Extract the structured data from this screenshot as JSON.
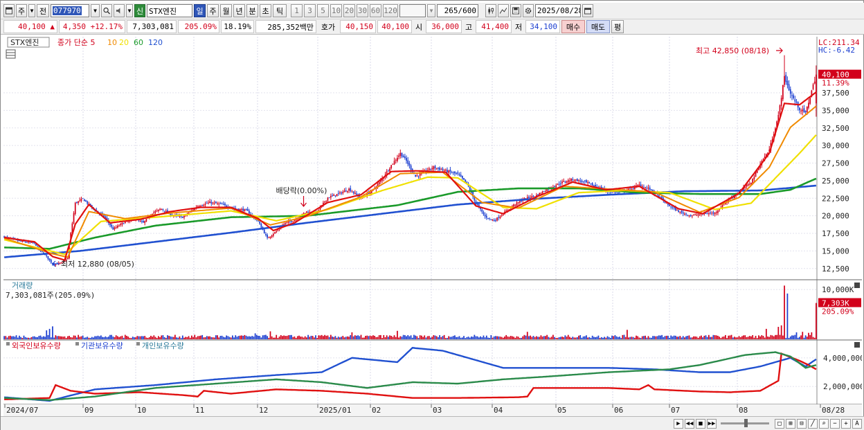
{
  "toolbar": {
    "mode_button": "주",
    "prev_button": "전",
    "stock_code": "077970",
    "new_badge": "신",
    "stock_name": "STX엔진",
    "period_tabs": [
      "일",
      "주",
      "월",
      "년",
      "분",
      "초",
      "틱"
    ],
    "active_period": "일",
    "interval_buttons": [
      "1",
      "3",
      "5",
      "10",
      "20",
      "30",
      "60",
      "120"
    ],
    "count_value": "265",
    "count_max": "/600",
    "date_value": "2025/08/28"
  },
  "quote": {
    "price": "40,100",
    "change_arrow": "▲",
    "change": "4,350",
    "change_pct": "+12.17%",
    "volume": "7,303,081",
    "volume_ratio": "205.09%",
    "turnover": "18.19%",
    "amount": "285,352백만",
    "bid_label": "호가",
    "ask_price": "40,150",
    "bid_price": "40,100",
    "open_label": "시",
    "open": "36,000",
    "high_label": "고",
    "high": "41,400",
    "low_label": "저",
    "low": "34,100",
    "buy_button": "매수",
    "sell_button": "매도",
    "eval_button": "평"
  },
  "colors": {
    "up": "#d2001b",
    "down": "#1c3fd0",
    "ma5": "#e01010",
    "ma10": "#f08a00",
    "ma20": "#f0e000",
    "ma60": "#1a9a2a",
    "ma120": "#2050d0",
    "foreign": "#2050d0",
    "institution": "#e01010",
    "individual": "#2a8a4a"
  },
  "chart_data": [
    {
      "type": "candlestick",
      "title": "STX엔진",
      "legend": {
        "price_label": "종가 단순",
        "periods": [
          "5",
          "10",
          "20",
          "60",
          "120"
        ]
      },
      "ylim": [
        11000,
        44500
      ],
      "yticks": [
        "37,500",
        "35,000",
        "32,500",
        "30,000",
        "27,500",
        "25,000",
        "22,500",
        "20,000",
        "17,500",
        "15,000",
        "12,500"
      ],
      "xticks": [
        "2024/07",
        "09",
        "10",
        "11",
        "12",
        "2025/01",
        "02",
        "03",
        "04",
        "05",
        "06",
        "07",
        "08",
        "08/28"
      ],
      "right_labels": {
        "lc": "LC:211.34",
        "hc": "HC:-6.42",
        "price_tag": "40,100",
        "pct_tag": "11.39%"
      },
      "annotations": {
        "high": "최고 42,850 (08/18)",
        "low": "최저 12,880 (08/05)",
        "dividend": "배당락(0.00%)"
      },
      "anchors": [
        [
          0,
          17000
        ],
        [
          10,
          16400
        ],
        [
          20,
          16100
        ],
        [
          24,
          15000
        ],
        [
          28,
          14200
        ],
        [
          32,
          13100
        ],
        [
          38,
          13300
        ],
        [
          42,
          14000
        ],
        [
          44,
          17500
        ],
        [
          47,
          21800
        ],
        [
          52,
          22400
        ],
        [
          58,
          21200
        ],
        [
          66,
          19900
        ],
        [
          72,
          18100
        ],
        [
          78,
          18900
        ],
        [
          86,
          19600
        ],
        [
          92,
          19000
        ],
        [
          98,
          20400
        ],
        [
          104,
          21000
        ],
        [
          110,
          20200
        ],
        [
          118,
          19800
        ],
        [
          128,
          21400
        ],
        [
          136,
          21900
        ],
        [
          144,
          21600
        ],
        [
          152,
          21000
        ],
        [
          160,
          20800
        ],
        [
          168,
          19200
        ],
        [
          174,
          16800
        ],
        [
          180,
          17800
        ],
        [
          186,
          19000
        ],
        [
          192,
          19400
        ],
        [
          200,
          20600
        ],
        [
          206,
          20300
        ],
        [
          214,
          22600
        ],
        [
          222,
          23200
        ],
        [
          228,
          23800
        ],
        [
          236,
          22500
        ],
        [
          244,
          23700
        ],
        [
          250,
          25300
        ],
        [
          256,
          27200
        ],
        [
          262,
          28900
        ],
        [
          266,
          27800
        ],
        [
          272,
          25600
        ],
        [
          278,
          26300
        ],
        [
          284,
          26900
        ],
        [
          292,
          26400
        ],
        [
          300,
          25900
        ],
        [
          306,
          24600
        ],
        [
          312,
          21800
        ],
        [
          318,
          19900
        ],
        [
          324,
          19300
        ],
        [
          330,
          20300
        ],
        [
          336,
          21400
        ],
        [
          344,
          22400
        ],
        [
          352,
          22900
        ],
        [
          360,
          23900
        ],
        [
          368,
          24700
        ],
        [
          376,
          25200
        ],
        [
          384,
          24800
        ],
        [
          390,
          24300
        ],
        [
          398,
          23600
        ],
        [
          406,
          23300
        ],
        [
          414,
          23800
        ],
        [
          420,
          24400
        ],
        [
          426,
          23900
        ],
        [
          432,
          23000
        ],
        [
          438,
          21700
        ],
        [
          446,
          20600
        ],
        [
          454,
          20000
        ],
        [
          462,
          20300
        ],
        [
          470,
          20400
        ],
        [
          478,
          22100
        ],
        [
          486,
          23400
        ],
        [
          494,
          24800
        ],
        [
          500,
          27400
        ],
        [
          506,
          29400
        ],
        [
          512,
          34200
        ],
        [
          516,
          39800
        ],
        [
          520,
          37400
        ],
        [
          526,
          35200
        ],
        [
          530,
          34600
        ],
        [
          534,
          37800
        ],
        [
          537,
          40100
        ]
      ],
      "ma_lines": {
        "ma5": [
          [
            0,
            16900
          ],
          [
            20,
            16300
          ],
          [
            32,
            14200
          ],
          [
            40,
            13700
          ],
          [
            47,
            18800
          ],
          [
            56,
            21600
          ],
          [
            70,
            19000
          ],
          [
            90,
            19500
          ],
          [
            110,
            20600
          ],
          [
            130,
            21200
          ],
          [
            150,
            21200
          ],
          [
            168,
            19600
          ],
          [
            178,
            17900
          ],
          [
            192,
            19000
          ],
          [
            214,
            21900
          ],
          [
            236,
            23000
          ],
          [
            256,
            26300
          ],
          [
            272,
            26400
          ],
          [
            292,
            26200
          ],
          [
            312,
            21400
          ],
          [
            330,
            20300
          ],
          [
            352,
            22700
          ],
          [
            376,
            24800
          ],
          [
            398,
            23700
          ],
          [
            420,
            24200
          ],
          [
            446,
            21000
          ],
          [
            462,
            20300
          ],
          [
            486,
            23200
          ],
          [
            506,
            28900
          ],
          [
            516,
            36000
          ],
          [
            526,
            35800
          ],
          [
            537,
            37600
          ]
        ],
        "ma10": [
          [
            0,
            16800
          ],
          [
            32,
            14600
          ],
          [
            42,
            14100
          ],
          [
            56,
            20600
          ],
          [
            80,
            19600
          ],
          [
            110,
            20400
          ],
          [
            150,
            21100
          ],
          [
            176,
            18700
          ],
          [
            200,
            19900
          ],
          [
            236,
            22700
          ],
          [
            262,
            26000
          ],
          [
            290,
            26200
          ],
          [
            316,
            21900
          ],
          [
            340,
            21100
          ],
          [
            370,
            24200
          ],
          [
            400,
            23800
          ],
          [
            430,
            23400
          ],
          [
            460,
            20500
          ],
          [
            486,
            22600
          ],
          [
            506,
            26900
          ],
          [
            520,
            32600
          ],
          [
            537,
            35600
          ]
        ],
        "ma20": [
          [
            0,
            16600
          ],
          [
            40,
            14500
          ],
          [
            64,
            19200
          ],
          [
            100,
            19800
          ],
          [
            150,
            20700
          ],
          [
            180,
            19300
          ],
          [
            214,
            20900
          ],
          [
            250,
            23600
          ],
          [
            280,
            25500
          ],
          [
            300,
            25400
          ],
          [
            330,
            21200
          ],
          [
            352,
            21000
          ],
          [
            380,
            23300
          ],
          [
            410,
            23600
          ],
          [
            440,
            23300
          ],
          [
            470,
            20900
          ],
          [
            494,
            21800
          ],
          [
            512,
            25800
          ],
          [
            526,
            28900
          ],
          [
            537,
            31500
          ]
        ],
        "ma60": [
          [
            0,
            15500
          ],
          [
            30,
            15300
          ],
          [
            60,
            16900
          ],
          [
            100,
            18600
          ],
          [
            150,
            19800
          ],
          [
            200,
            20000
          ],
          [
            260,
            21500
          ],
          [
            300,
            23400
          ],
          [
            340,
            23900
          ],
          [
            380,
            23900
          ],
          [
            420,
            23300
          ],
          [
            460,
            23100
          ],
          [
            500,
            23100
          ],
          [
            520,
            23700
          ],
          [
            537,
            25300
          ]
        ],
        "ma120": [
          [
            0,
            14100
          ],
          [
            50,
            15000
          ],
          [
            100,
            16300
          ],
          [
            150,
            17600
          ],
          [
            200,
            19000
          ],
          [
            250,
            20300
          ],
          [
            300,
            21600
          ],
          [
            350,
            22400
          ],
          [
            400,
            23000
          ],
          [
            450,
            23500
          ],
          [
            500,
            23600
          ],
          [
            537,
            24300
          ]
        ]
      }
    },
    {
      "type": "bar",
      "title": "거래량",
      "subtitle": "7,303,081주(205.09%)",
      "ylim": [
        0,
        11000
      ],
      "yticks": [
        "10,000K"
      ],
      "right_labels": {
        "price_tag": "7,303K",
        "pct_tag": "205.09%"
      },
      "spikes": [
        [
          28,
          1800
        ],
        [
          30,
          2100
        ],
        [
          32,
          2600
        ],
        [
          166,
          1200
        ],
        [
          176,
          1600
        ],
        [
          230,
          1400
        ],
        [
          260,
          1700
        ],
        [
          346,
          1500
        ],
        [
          412,
          1900
        ],
        [
          504,
          2100
        ],
        [
          512,
          2500
        ],
        [
          514,
          2800
        ],
        [
          516,
          10800
        ],
        [
          518,
          9200
        ],
        [
          524,
          1400
        ],
        [
          528,
          1500
        ],
        [
          532,
          1300
        ],
        [
          534,
          1400
        ],
        [
          537,
          7303
        ]
      ]
    },
    {
      "type": "line",
      "legend": [
        "외국인보유수량",
        "기관보유수량",
        "개인보유수량"
      ],
      "ylim": [
        800000,
        5200000
      ],
      "yticks": [
        "4,000,000",
        "2,000,000"
      ],
      "series": [
        {
          "name": "외국인보유수량",
          "points": [
            [
              0,
              1250000
            ],
            [
              30,
              1000000
            ],
            [
              60,
              1800000
            ],
            [
              100,
              2100000
            ],
            [
              140,
              2500000
            ],
            [
              180,
              2800000
            ],
            [
              210,
              3000000
            ],
            [
              230,
              4000000
            ],
            [
              250,
              3800000
            ],
            [
              260,
              3700000
            ],
            [
              270,
              4700000
            ],
            [
              290,
              4500000
            ],
            [
              310,
              3900000
            ],
            [
              330,
              3300000
            ],
            [
              360,
              3300000
            ],
            [
              400,
              3300000
            ],
            [
              430,
              3200000
            ],
            [
              460,
              3000000
            ],
            [
              480,
              3000000
            ],
            [
              500,
              3400000
            ],
            [
              520,
              4000000
            ],
            [
              530,
              3400000
            ],
            [
              537,
              3900000
            ]
          ]
        },
        {
          "name": "기관보유수량",
          "points": [
            [
              0,
              1100000
            ],
            [
              30,
              1200000
            ],
            [
              34,
              2100000
            ],
            [
              44,
              1700000
            ],
            [
              60,
              1500000
            ],
            [
              90,
              1600000
            ],
            [
              118,
              1400000
            ],
            [
              128,
              1300000
            ],
            [
              132,
              1700000
            ],
            [
              150,
              1500000
            ],
            [
              180,
              1800000
            ],
            [
              210,
              1700000
            ],
            [
              240,
              1500000
            ],
            [
              270,
              1200000
            ],
            [
              300,
              1200000
            ],
            [
              340,
              1250000
            ],
            [
              346,
              1300000
            ],
            [
              350,
              1900000
            ],
            [
              380,
              1900000
            ],
            [
              400,
              1900000
            ],
            [
              420,
              1800000
            ],
            [
              426,
              2100000
            ],
            [
              430,
              1800000
            ],
            [
              460,
              1650000
            ],
            [
              480,
              1600000
            ],
            [
              500,
              1700000
            ],
            [
              512,
              2400000
            ],
            [
              514,
              4300000
            ],
            [
              526,
              3800000
            ],
            [
              532,
              3500000
            ],
            [
              537,
              3200000
            ]
          ]
        },
        {
          "name": "개인보유수량",
          "points": [
            [
              0,
              1200000
            ],
            [
              30,
              1050000
            ],
            [
              60,
              1300000
            ],
            [
              100,
              1900000
            ],
            [
              140,
              2200000
            ],
            [
              180,
              2500000
            ],
            [
              210,
              2300000
            ],
            [
              240,
              1900000
            ],
            [
              270,
              2300000
            ],
            [
              300,
              2200000
            ],
            [
              330,
              2500000
            ],
            [
              360,
              2700000
            ],
            [
              400,
              3000000
            ],
            [
              440,
              3200000
            ],
            [
              460,
              3500000
            ],
            [
              490,
              4200000
            ],
            [
              510,
              4400000
            ],
            [
              520,
              4100000
            ],
            [
              530,
              3300000
            ],
            [
              537,
              3500000
            ]
          ]
        }
      ]
    }
  ]
}
